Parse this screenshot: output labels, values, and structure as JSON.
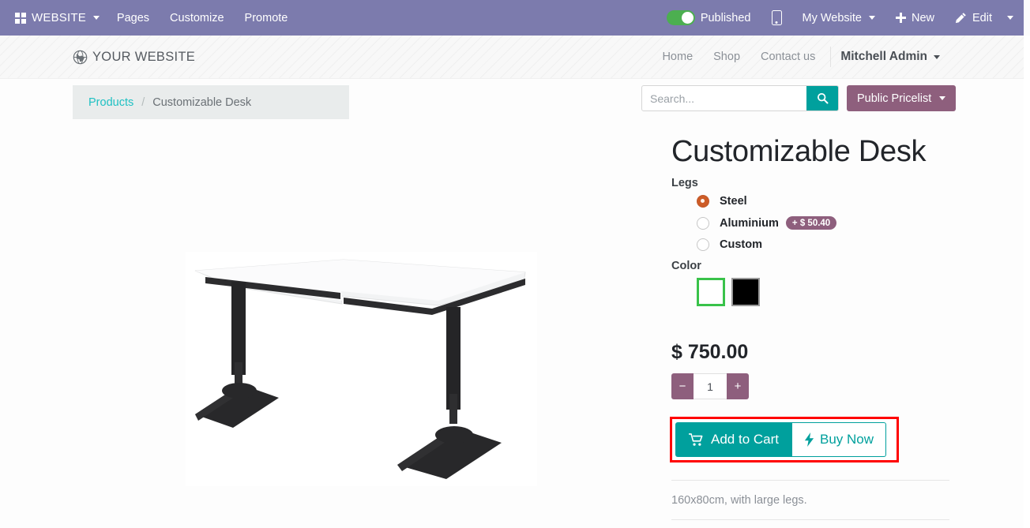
{
  "topbar": {
    "apps_label": "WEBSITE",
    "apps_icon": "grid-icon",
    "menu": [
      {
        "label": "Pages"
      },
      {
        "label": "Customize"
      },
      {
        "label": "Promote"
      }
    ],
    "published_label": "Published",
    "published_state": "on",
    "mobile_icon": "mobile-preview-icon",
    "website_selector": "My Website",
    "new_label": "New",
    "new_icon": "plus-icon",
    "edit_label": "Edit",
    "edit_icon": "pencil-icon",
    "background_color": "#7c7bad",
    "toggle_on_color": "#4caf50"
  },
  "site_header": {
    "brand_name": "YOUR WEBSITE",
    "brand_icon": "globe-icon",
    "nav": [
      {
        "label": "Home"
      },
      {
        "label": "Shop"
      },
      {
        "label": "Contact us"
      }
    ],
    "user_name": "Mitchell Admin"
  },
  "breadcrumb": {
    "parent": "Products",
    "separator": "/",
    "current": "Customizable Desk"
  },
  "search": {
    "placeholder": "Search...",
    "value": "",
    "button_icon": "search-icon",
    "button_color": "#00a09d"
  },
  "pricelist": {
    "label": "Public Pricelist",
    "color": "#8e5f7d"
  },
  "product": {
    "title": "Customizable Desk",
    "price": "$ 750.00",
    "quantity": "1",
    "description": "160x80cm, with large legs.",
    "image_alt": "customizable-desk-image",
    "attributes": [
      {
        "name": "Legs",
        "type": "radio",
        "options": [
          {
            "label": "Steel",
            "selected": true,
            "extra_price": ""
          },
          {
            "label": "Aluminium",
            "selected": false,
            "extra_price": "+ $ 50.40"
          },
          {
            "label": "Custom",
            "selected": false,
            "extra_price": ""
          }
        ]
      },
      {
        "name": "Color",
        "type": "swatch",
        "options": [
          {
            "label": "White",
            "color": "#ffffff",
            "selected": true
          },
          {
            "label": "Black",
            "color": "#000000",
            "selected": false
          }
        ]
      }
    ],
    "qty_decrease": "−",
    "qty_increase": "+",
    "add_to_cart_label": "Add to Cart",
    "add_to_cart_icon": "shopping-cart-icon",
    "buy_now_label": "Buy Now",
    "buy_now_icon": "lightning-bolt-icon",
    "selected_radio_color": "#cd5c27",
    "selected_swatch_border": "#39c24a",
    "highlight_color": "#ff0000"
  }
}
